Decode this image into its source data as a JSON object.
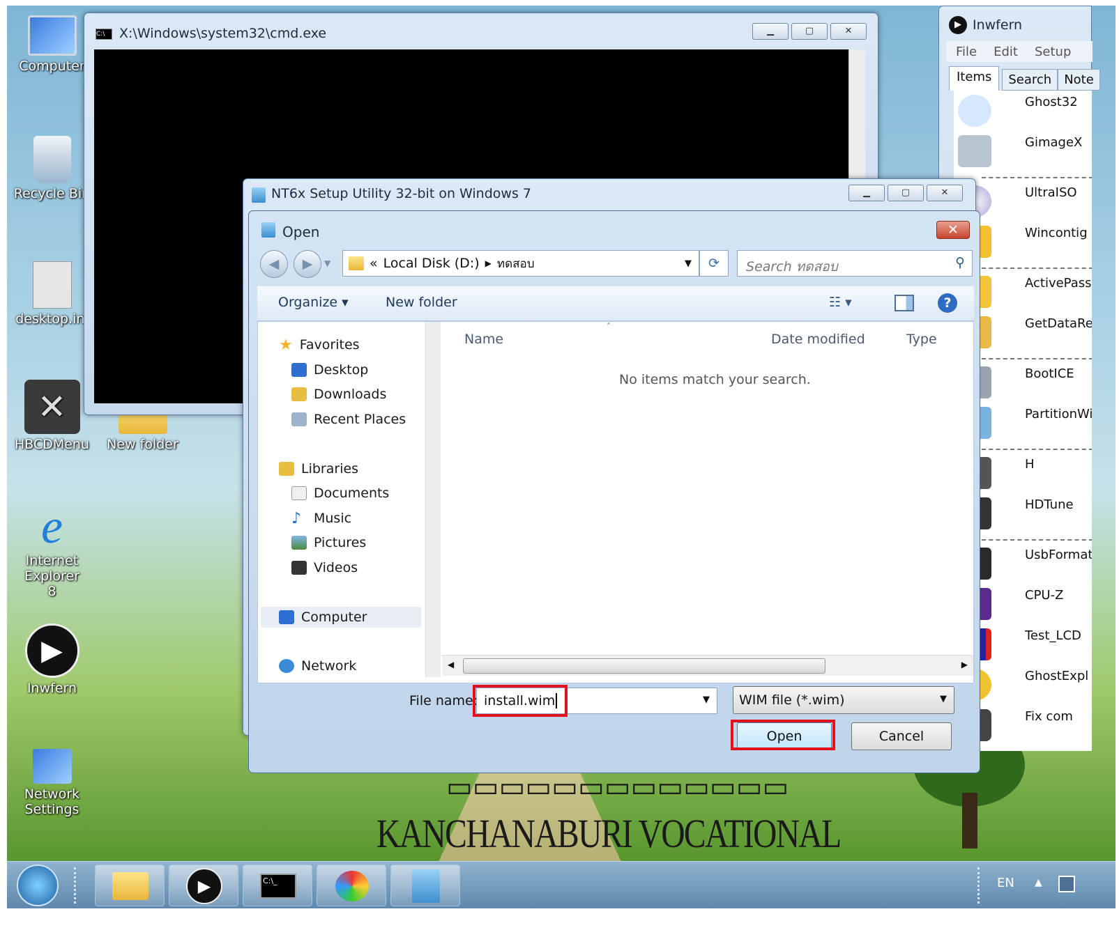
{
  "desktop": {
    "icons": [
      {
        "label": "Computer"
      },
      {
        "label": "Recycle Bin"
      },
      {
        "label": "desktop.ini"
      },
      {
        "label": "HBCDMenu"
      },
      {
        "label": "New folder"
      },
      {
        "label": "Internet Explorer 8"
      },
      {
        "label": "Inwfern"
      },
      {
        "label": "Network Settings"
      }
    ],
    "banner_en": "KANCHANABURI  VOCATIONAL  COLLEGE"
  },
  "cmd": {
    "title": "X:\\Windows\\system32\\cmd.exe"
  },
  "nt6": {
    "title": "NT6x Setup Utility 32-bit on Windows 7"
  },
  "open_dialog": {
    "title": "Open",
    "address": {
      "crumb_prefix": "«",
      "location": "Local Disk (D:)",
      "subfolder": "ทดสอบ"
    },
    "search_placeholder": "Search ทดสอบ",
    "toolbar": {
      "organize": "Organize",
      "new_folder": "New folder"
    },
    "nav": {
      "favorites": "Favorites",
      "favorites_items": [
        "Desktop",
        "Downloads",
        "Recent Places"
      ],
      "libraries": "Libraries",
      "libraries_items": [
        "Documents",
        "Music",
        "Pictures",
        "Videos"
      ],
      "computer": "Computer",
      "network": "Network"
    },
    "columns": {
      "name": "Name",
      "date_modified": "Date modified",
      "type": "Type"
    },
    "empty_message": "No items match your search.",
    "file_name_label": "File name:",
    "file_name_value": "install.wim",
    "file_type": "WIM file (*.wim)",
    "open_button": "Open",
    "cancel_button": "Cancel"
  },
  "inwfern": {
    "title": "Inwfern",
    "menu": [
      "File",
      "Edit",
      "Setup"
    ],
    "tabs": [
      "Items",
      "Search",
      "Note"
    ],
    "items": [
      "Ghost32",
      "GimageX",
      "UltraISO",
      "Wincontig",
      "ActivePass",
      "GetDataRe",
      "BootICE",
      "PartitionWi",
      "H",
      "HDTune",
      "UsbFormat",
      "CPU-Z",
      "Test_LCD",
      "GhostExpl",
      "Fix com"
    ]
  },
  "taskbar": {
    "lang": "EN"
  }
}
